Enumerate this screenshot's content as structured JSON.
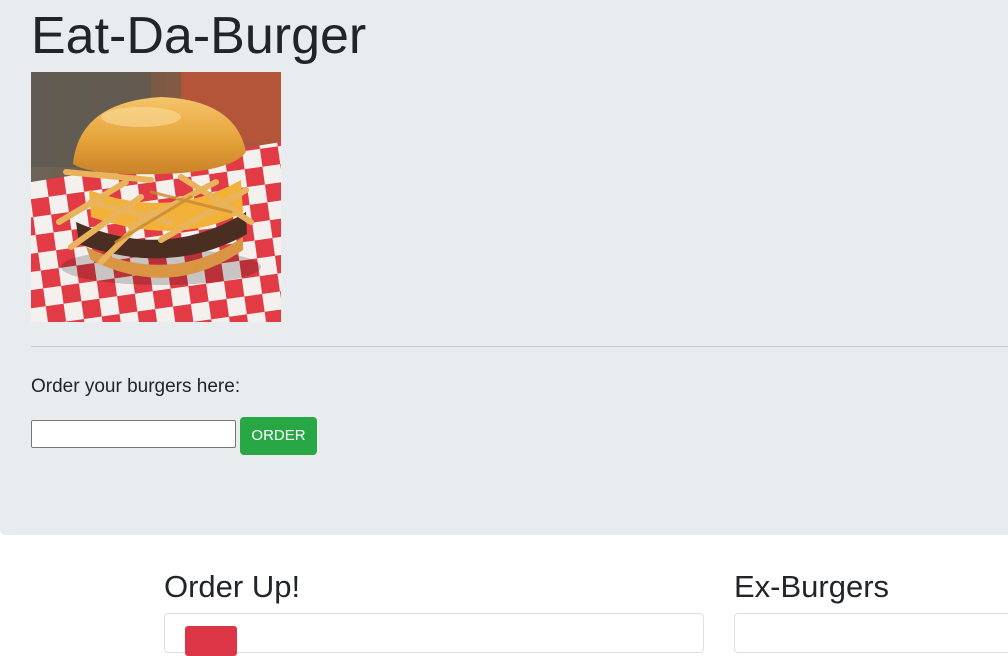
{
  "header": {
    "title": "Eat-Da-Burger"
  },
  "order_form": {
    "prompt": "Order your burgers here:",
    "input_value": "",
    "input_placeholder": "",
    "order_button_label": "ORDER"
  },
  "sections": {
    "order_up_title": "Order Up!",
    "ex_burgers_title": "Ex-Burgers"
  },
  "colors": {
    "jumbotron_bg": "#e9ecef",
    "order_button": "#28a745",
    "devour_button": "#dc3545"
  }
}
